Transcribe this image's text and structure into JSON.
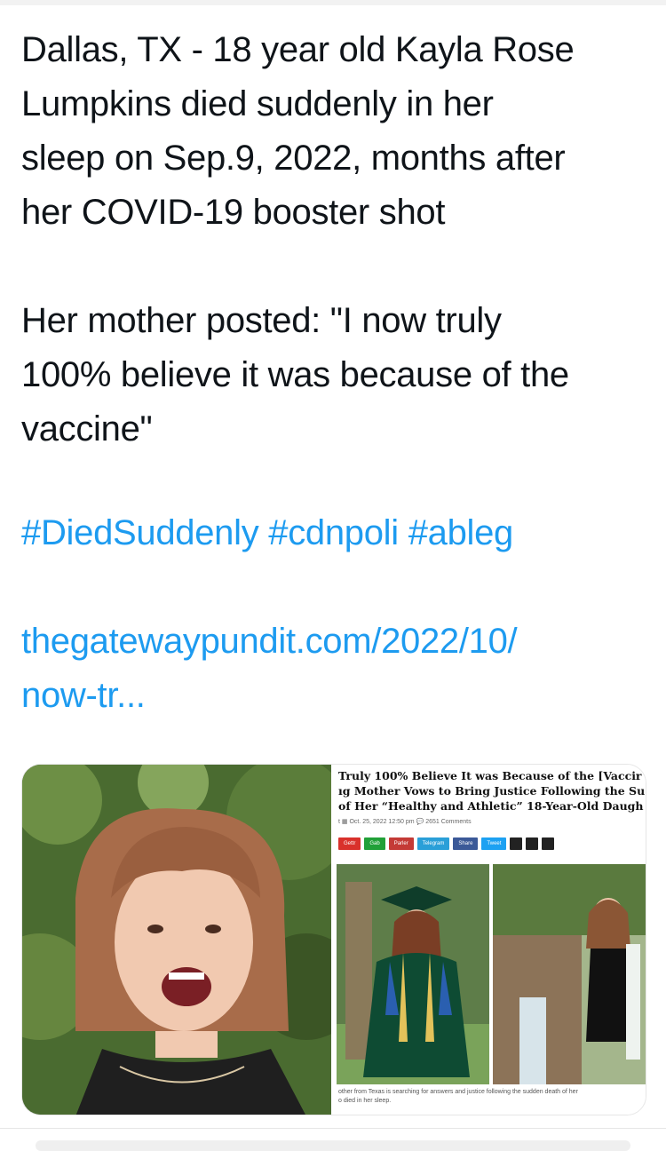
{
  "tweet": {
    "line1": "Dallas, TX - 18 year old Kayla Rose",
    "line2": "Lumpkins died suddenly in her",
    "line3": "sleep on Sep.9, 2022, months after",
    "line4": "her COVID-19 booster shot",
    "line5": "Her mother posted: \"I now truly",
    "line6": "100% believe it was because of the",
    "line7": "vaccine\""
  },
  "hashtags": [
    "#DiedSuddenly",
    "#cdnpoli",
    "#ableg"
  ],
  "link": {
    "line1": "thegatewaypundit.com/2022/10/",
    "line2": "now-tr..."
  },
  "article": {
    "title1": "Truly 100% Believe It was Because of the [Vaccir",
    "title2": "ıg Mother Vows to Bring Justice Following the Su",
    "title3": "of Her “Healthy and Athletic” 18-Year-Old Daugh",
    "meta": "t  ▦ Oct. 25, 2022 12:50 pm  💬 2651 Comments",
    "share": [
      "Gettr",
      "Gab",
      "Parler",
      "Telegram",
      "Share",
      "Tweet"
    ],
    "caption1": "other from Texas is searching for answers and justice following the sudden death of her",
    "caption2": "o died in her sleep."
  },
  "colors": {
    "link": "#1d9bf0",
    "text": "#0f1419"
  }
}
